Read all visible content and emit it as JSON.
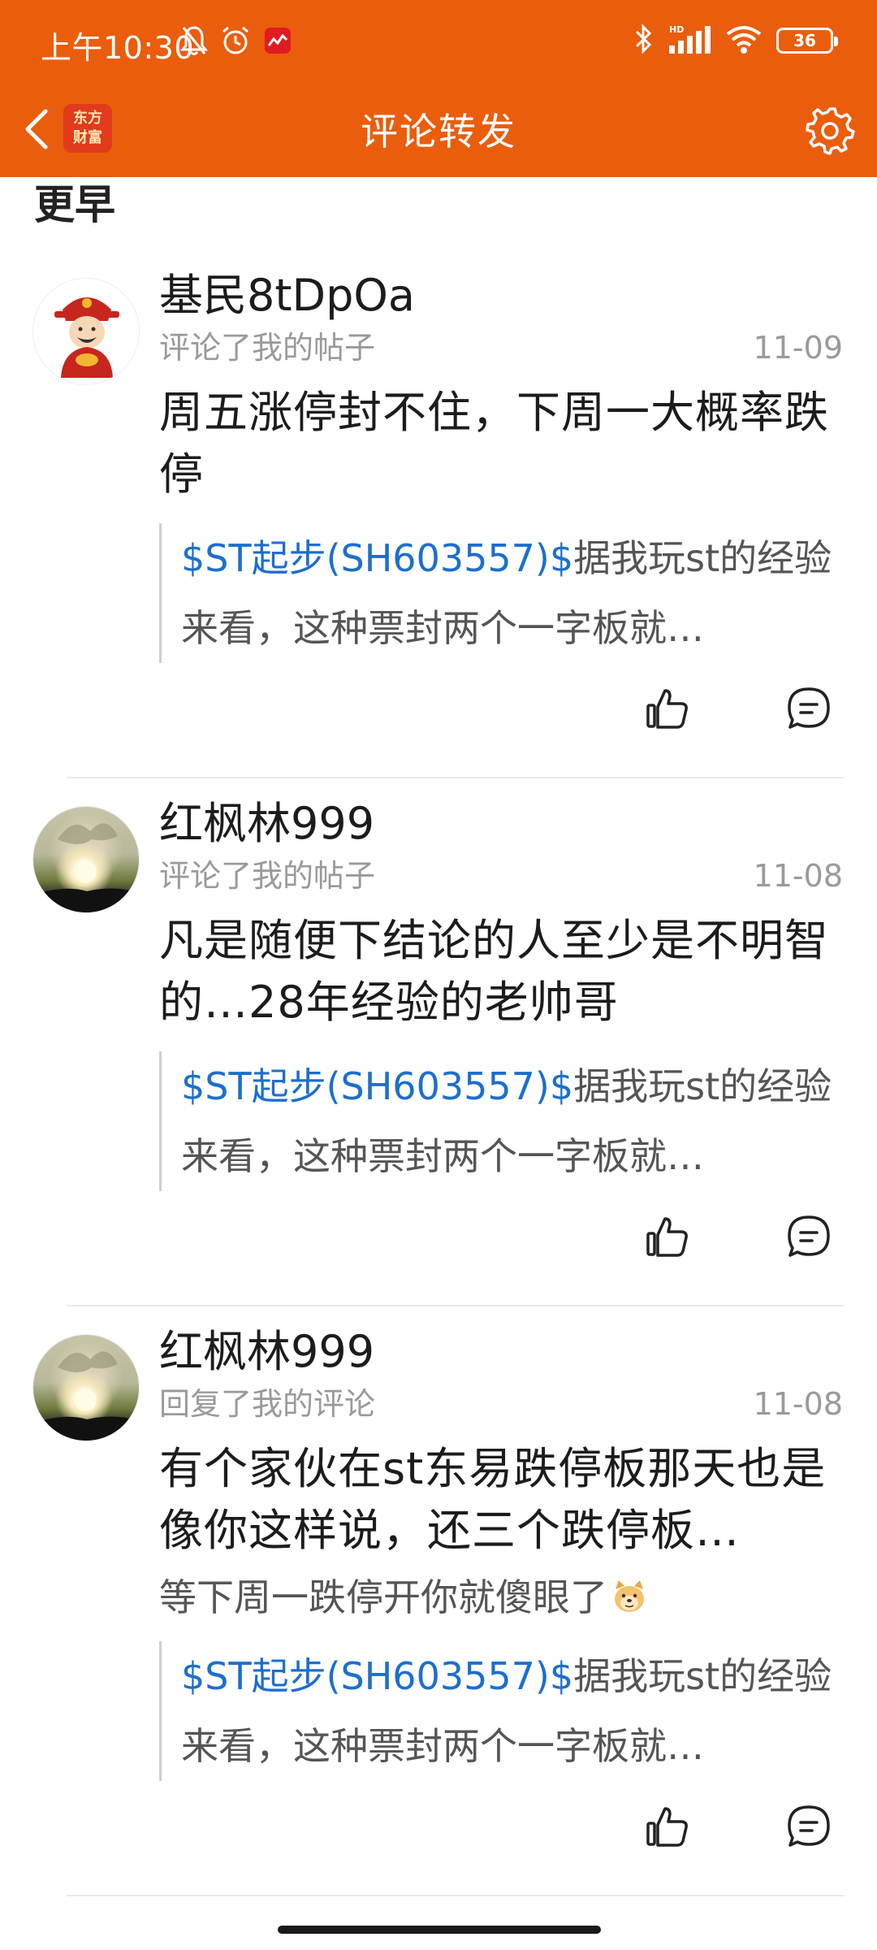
{
  "status_bar": {
    "time": "上午10:30",
    "battery": "36"
  },
  "header": {
    "title": "评论转发",
    "brand_logo_line1": "东方",
    "brand_logo_line2": "财富",
    "brand_color": "#EA5D0C"
  },
  "section": {
    "heading": "更早"
  },
  "items": [
    {
      "username": "基民8tDpOa",
      "action": "评论了我的帖子",
      "date": "11-09",
      "comment": "周五涨停封不住，下周一大概率跌停",
      "reply": "",
      "quote_stock": "$ST起步(SH603557)$",
      "quote_text": "据我玩st的经验来看，这种票封两个一字板就…",
      "avatar": "caishen-avatar"
    },
    {
      "username": "红枫林999",
      "action": "评论了我的帖子",
      "date": "11-08",
      "comment": "凡是随便下结论的人至少是不明智的…28年经验的老帅哥",
      "reply": "",
      "quote_stock": "$ST起步(SH603557)$",
      "quote_text": "据我玩st的经验来看，这种票封两个一字板就…",
      "avatar": "sunset-tree-avatar"
    },
    {
      "username": "红枫林999",
      "action": "回复了我的评论",
      "date": "11-08",
      "comment": "有个家伙在st东易跌停板那天也是像你这样说，还三个跌停板…",
      "reply": "等下周一跌停开你就傻眼了",
      "quote_stock": "$ST起步(SH603557)$",
      "quote_text": "据我玩st的经验来看，这种票封两个一字板就…",
      "avatar": "sunset-tree-avatar"
    }
  ],
  "colors": {
    "stock_link": "#1C6FCF",
    "meta": "#9A9A9A"
  }
}
